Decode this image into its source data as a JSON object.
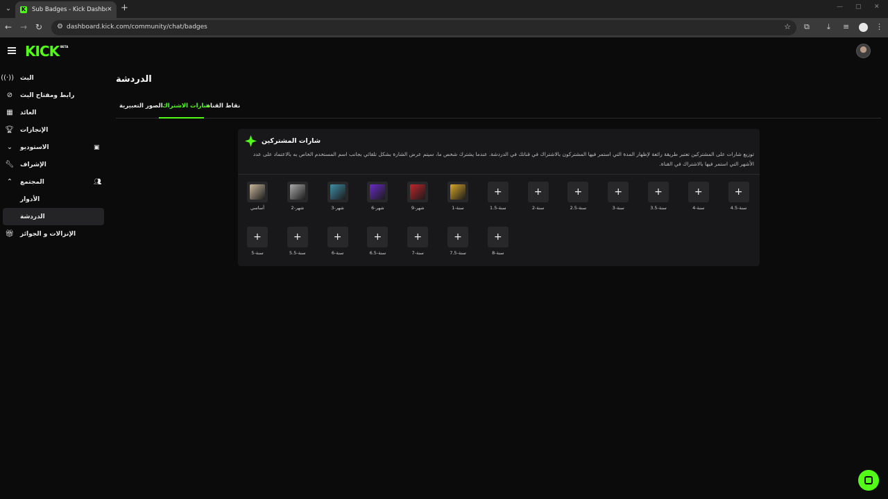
{
  "browser": {
    "tab_title": "Sub Badges - Kick Dashboard",
    "url": "dashboard.kick.com/community/chat/badges"
  },
  "app": {
    "logo": "KICK",
    "beta": "BETA",
    "accent": "#53fc18"
  },
  "sidebar": {
    "items": [
      {
        "label": "البث",
        "icon": "broadcast-icon"
      },
      {
        "label": "رابط ومفتاح البث",
        "icon": "link-icon"
      },
      {
        "label": "العائد",
        "icon": "chart-icon"
      },
      {
        "label": "الإنجازات",
        "icon": "trophy-icon"
      },
      {
        "label": "الاستوديو",
        "icon": "chevron-down-icon"
      },
      {
        "label": "الإشراف",
        "icon": "wrench-icon"
      },
      {
        "label": "المجتمع",
        "icon": "chevron-up-icon"
      },
      {
        "label": "الأدوار",
        "icon": ""
      },
      {
        "label": "الدردشة",
        "icon": ""
      },
      {
        "label": "الإنزالات و الجوائز",
        "icon": "gift-icon"
      }
    ]
  },
  "main": {
    "title": "الدردشة",
    "tabs": [
      {
        "label": "نقاط القناة"
      },
      {
        "label": "شارات الاشتراك"
      },
      {
        "label": "الصور التعبيرية"
      }
    ]
  },
  "card": {
    "title": "شارات المشتركين",
    "description": "توزيع شارات على المشتركين تعتبر طريقة رائعة لإظهار المدة التي استمر فيها المشتركون بالاشتراك في قناتك في الدردشة. عندما يشترك شخص ما، سيتم عرض الشارة بشكل تلقائي بجانب اسم المستخدم الخاص به بالاعتماد على عدد الأشهر التي استمر فيها بالاشتراك في القناة.",
    "badges_row1": [
      {
        "label": "أساسي",
        "type": "image",
        "color": "#c9b79c"
      },
      {
        "label": "شهر-2",
        "type": "image",
        "color": "#a9a9a9"
      },
      {
        "label": "شهر-3",
        "type": "image",
        "color": "#3f8fa8"
      },
      {
        "label": "شهر-6",
        "type": "image",
        "color": "#6a2bc9"
      },
      {
        "label": "شهر-9",
        "type": "image",
        "color": "#c0262b"
      },
      {
        "label": "سنة-1",
        "type": "image",
        "color": "#d7a72a"
      },
      {
        "label": "سنة-1.5",
        "type": "add"
      },
      {
        "label": "سنة-2",
        "type": "add"
      },
      {
        "label": "سنة-2.5",
        "type": "add"
      },
      {
        "label": "سنة-3",
        "type": "add"
      },
      {
        "label": "سنة-3.5",
        "type": "add"
      },
      {
        "label": "سنة-4",
        "type": "add"
      },
      {
        "label": "سنة-4.5",
        "type": "add"
      }
    ],
    "badges_row2": [
      {
        "label": "سنة-5",
        "type": "add"
      },
      {
        "label": "سنة-5.5",
        "type": "add"
      },
      {
        "label": "سنة-6",
        "type": "add"
      },
      {
        "label": "سنة-6.5",
        "type": "add"
      },
      {
        "label": "سنة-7",
        "type": "add"
      },
      {
        "label": "سنة-7.5",
        "type": "add"
      },
      {
        "label": "سنة-8",
        "type": "add"
      }
    ]
  }
}
